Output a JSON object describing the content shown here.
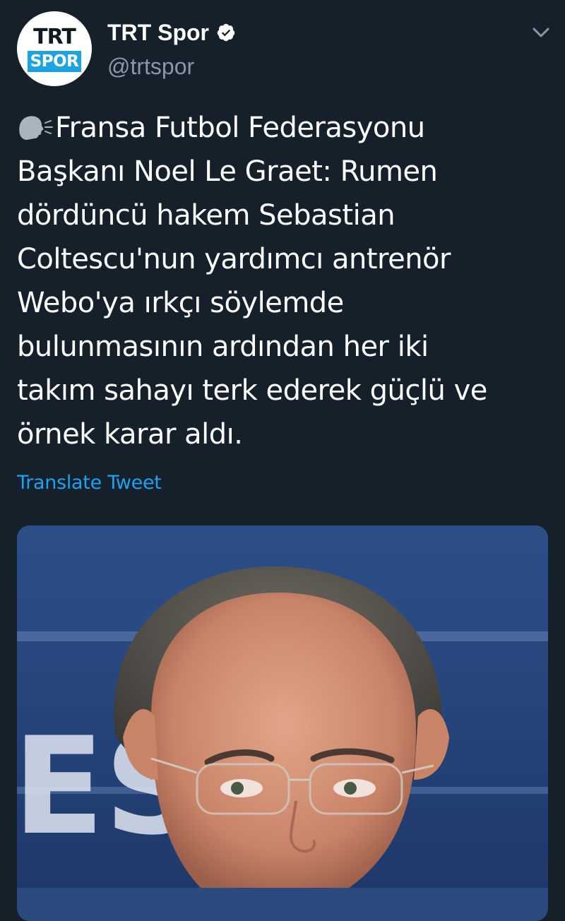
{
  "account": {
    "display_name": "TRT Spor",
    "handle": "@trtspor",
    "avatar_logo_top": "TRT",
    "avatar_logo_bottom": "SPOR",
    "verified": true
  },
  "tweet": {
    "text_lines": [
      "Fransa Futbol Federasyonu",
      "Başkanı Noel Le Graet: Rumen",
      "dördüncü hakem Sebastian",
      "Coltescu'nun yardımcı antrenör",
      "Webo'ya ırkçı söylemde",
      "bulunmasının ardından her iki",
      "takım sahayı terk ederek güçlü ve",
      "örnek karar aldı."
    ],
    "leading_icon": "speaking-head-icon",
    "translate_label": "Translate Tweet"
  },
  "media": {
    "background_letters": "ES  T"
  },
  "colors": {
    "background": "#15202b",
    "primary_text": "#ffffff",
    "secondary_text": "#8899a6",
    "link": "#1da1f2",
    "brand_blue": "#1da3e0"
  }
}
